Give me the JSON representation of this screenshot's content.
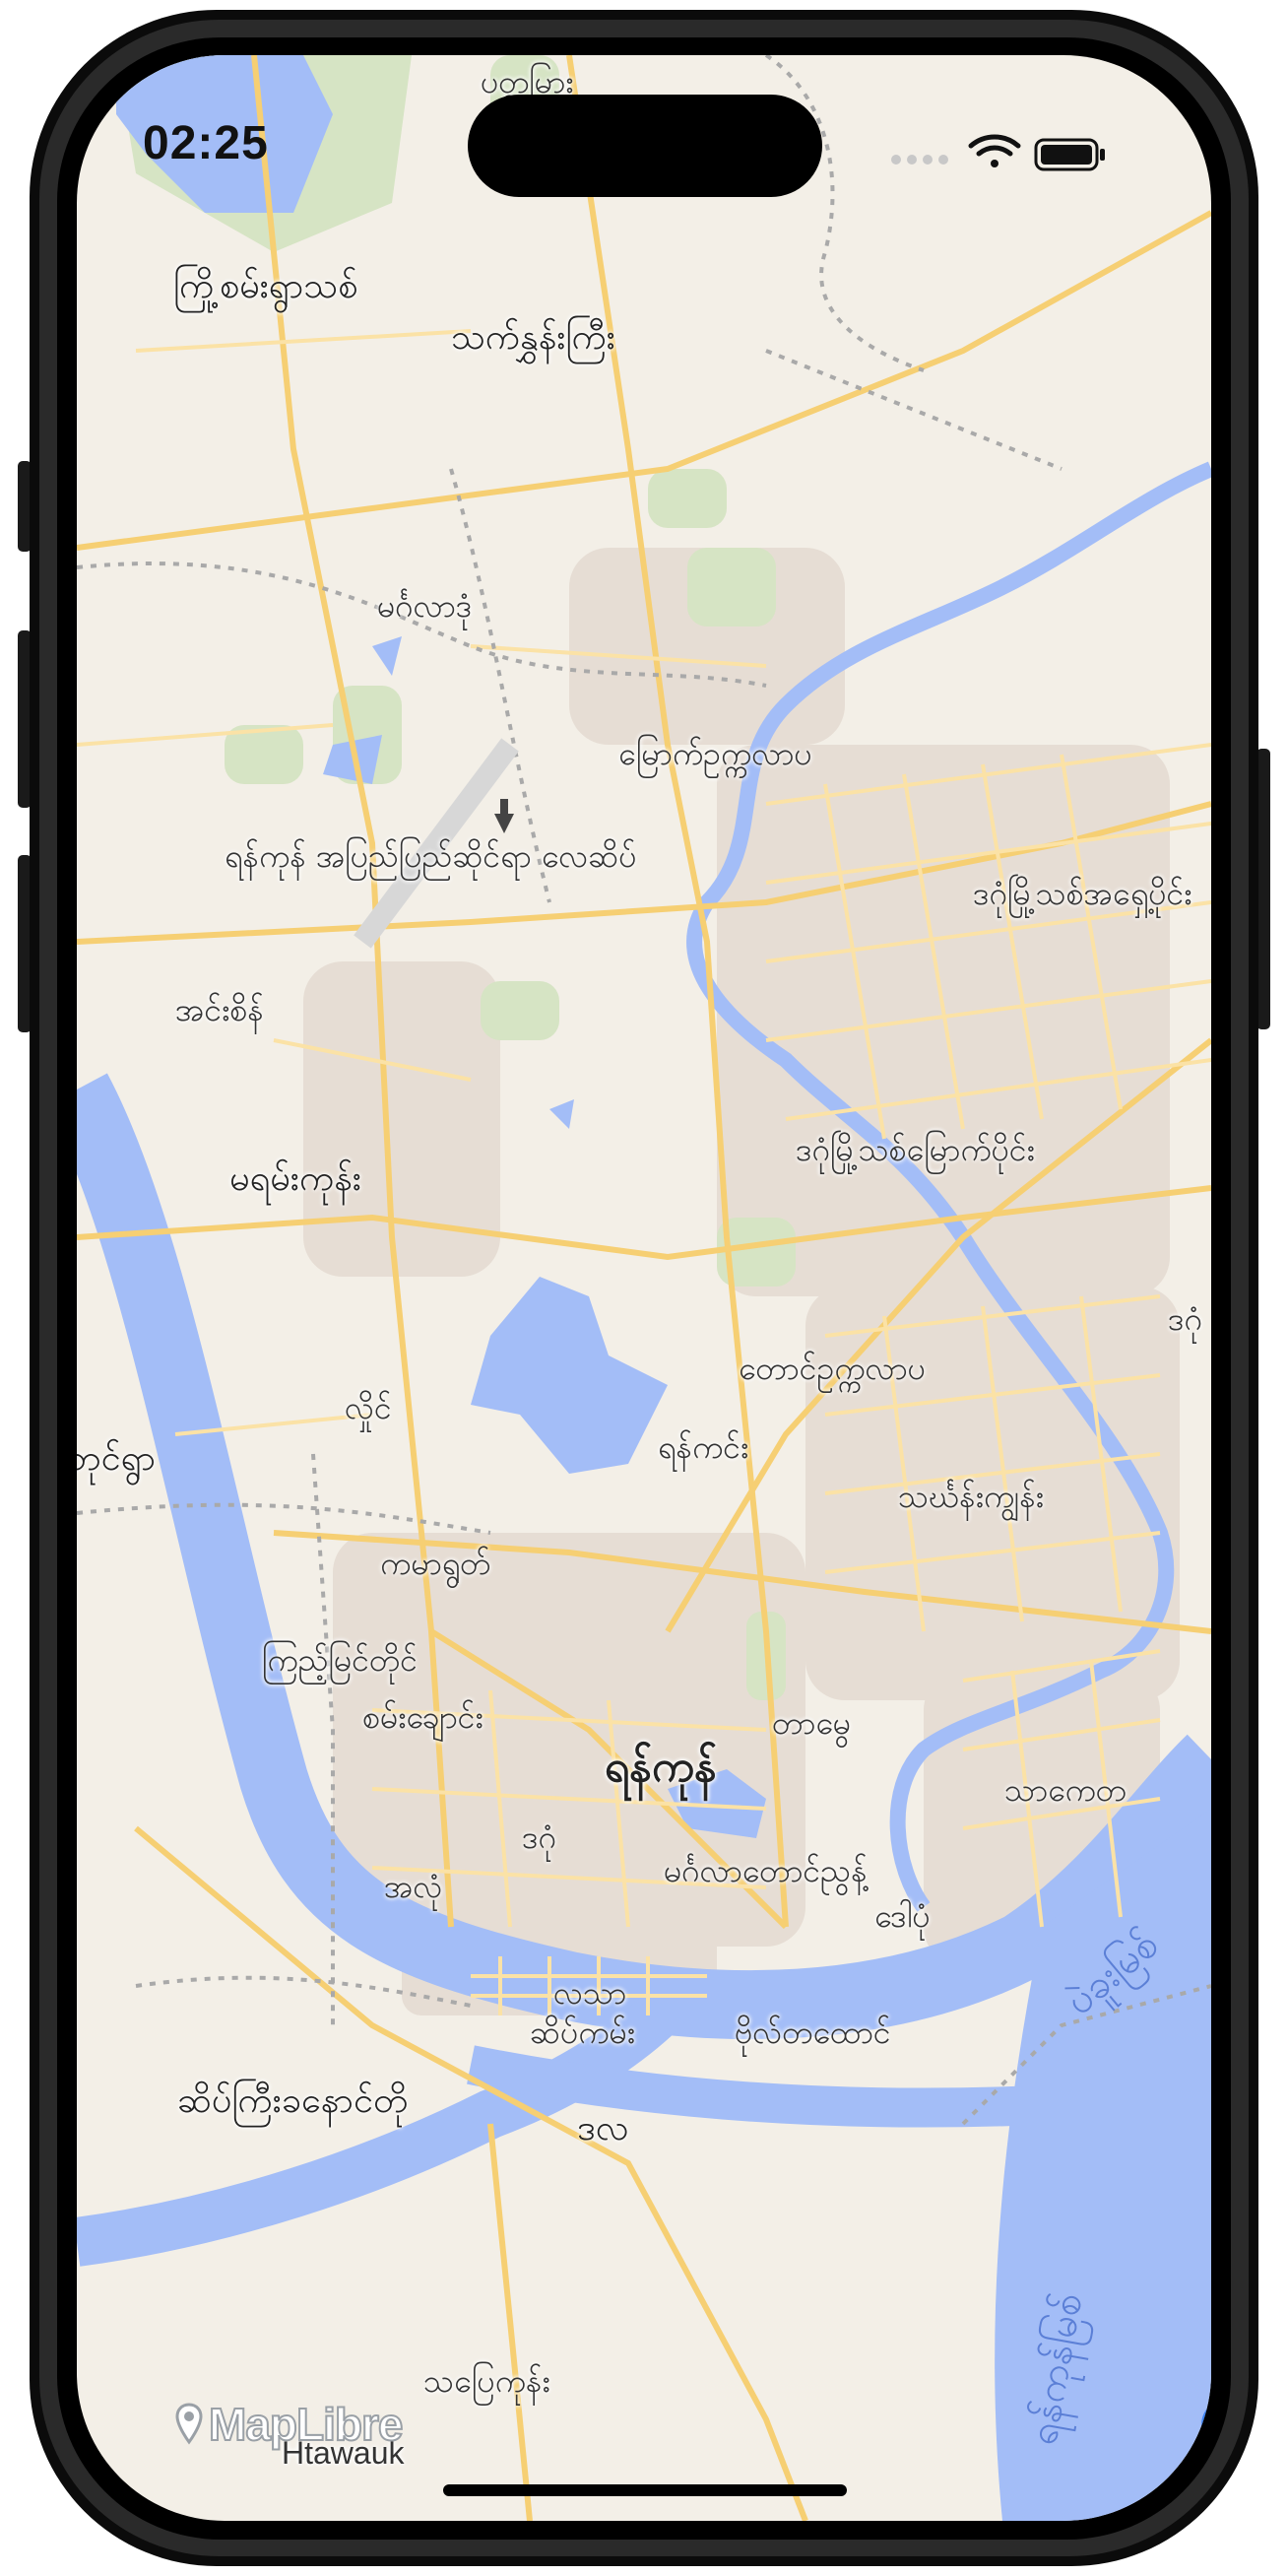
{
  "status_bar": {
    "time": "02:25",
    "icons": [
      "cellular-dots-icon",
      "wifi-icon",
      "battery-icon"
    ]
  },
  "map": {
    "colors": {
      "land": "#f3efe7",
      "water": "#a3bdf7",
      "road_major": "#f6cf73",
      "road_minor": "#fbe2a6",
      "park": "#d6e4c4",
      "urban": "#e6ddd4",
      "boundary": "#a9a9a9"
    },
    "labels": {
      "pattamyar": "ပတ္တမြား",
      "kyoechitmin": "ကြို့စမ်းရွာသစ်",
      "thetkone": "သက်နွှန်းကြီး",
      "mingaladon": "မင်္ဂလာဒုံ",
      "myaukokkala": "မြောက်ဥက္ကလာပ",
      "airport": "ရန်ကုန် အပြည်ပြည်ဆိုင်ရာ လေဆိပ်",
      "dagon_myothit_south": "ဒဂုံမြို့သစ်အရှေ့ပိုင်း",
      "insein": "အင်းစိန်",
      "dagon_myothit_north": "ဒဂုံမြို့သစ်မြောက်ပိုင်း",
      "mayangone": "မရမ်းကုန်း",
      "dagon_edge": "ဒဂုံ",
      "hlaing": "လှိုင်",
      "south_okkalapa": "တောင်ဥက္ကလာပ",
      "hlaingtharyar": "ဘုင်ရွာ",
      "yankin": "ရန်ကင်း",
      "thingangyun": "သင်္ဃန်းကျွန်း",
      "kamayut": "ကမာရွတ်",
      "kyimyindaing": "ကြည့်မြင်တိုင်",
      "sanchaung": "စမ်းချောင်း",
      "tamwe": "တာမွေ",
      "yangon": "ရန်ကုန်",
      "thaketa": "သာကေတ",
      "dagon": "ဒဂုံ",
      "ahlone": "အလုံ",
      "mingala_taungnyunt": "မင်္ဂလာတောင်ညွန့်",
      "dawbon": "ဒေါပုံ",
      "lanmadaw": "လသာ",
      "seikkan": "ဆိပ်ကမ်း",
      "botataung": "ဗိုလ်တထောင်",
      "bago_river": "ပဲခူးမြစ်",
      "seikgyi": "ဆိပ်ကြီးခနောင်တို",
      "dala": "ဒလ",
      "yangon_river": "ရန်ကုန်မြစ်",
      "thanlyin": "သပြေကုန်း",
      "htawauk": "Htawauk"
    }
  },
  "attribution": {
    "logo_text": "MapLibre",
    "info_symbol": "i"
  }
}
